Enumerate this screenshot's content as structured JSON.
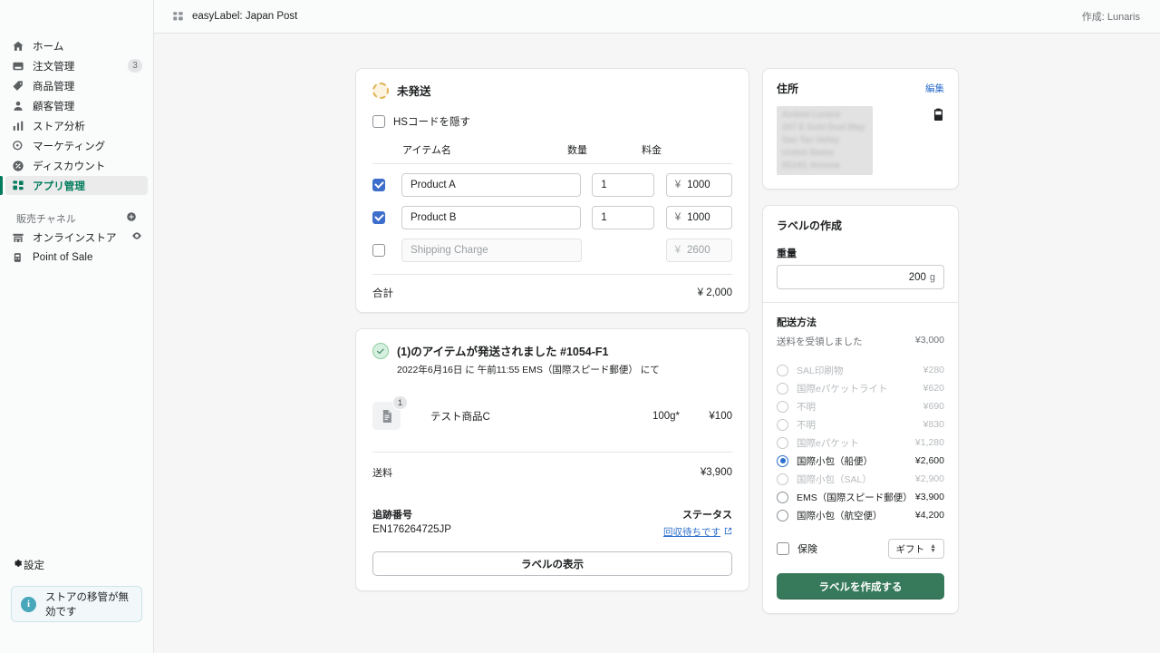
{
  "sidebar": {
    "items": [
      {
        "label": "ホーム",
        "icon": "home-icon",
        "badge": ""
      },
      {
        "label": "注文管理",
        "icon": "orders-icon",
        "badge": "3"
      },
      {
        "label": "商品管理",
        "icon": "products-icon",
        "badge": ""
      },
      {
        "label": "顧客管理",
        "icon": "customers-icon",
        "badge": ""
      },
      {
        "label": "ストア分析",
        "icon": "analytics-icon",
        "badge": ""
      },
      {
        "label": "マーケティング",
        "icon": "marketing-icon",
        "badge": ""
      },
      {
        "label": "ディスカウント",
        "icon": "discount-icon",
        "badge": ""
      },
      {
        "label": "アプリ管理",
        "icon": "apps-icon",
        "badge": ""
      }
    ],
    "active_index": 7,
    "section_title": "販売チャネル",
    "channels": [
      {
        "label": "オンラインストア",
        "icon": "store-icon",
        "trailing_icon": "eye-icon"
      },
      {
        "label": "Point of Sale",
        "icon": "pos-icon",
        "trailing_icon": ""
      }
    ],
    "settings_label": "設定",
    "notice": {
      "text": "ストアの移管が無効です",
      "icon": "info-icon"
    }
  },
  "topbar": {
    "app_icon": "apps-grid-icon",
    "app_name": "easyLabel: Japan Post",
    "author": "作成: Lunaris"
  },
  "unfulfilled": {
    "status_label": "未発送",
    "status_icon": "dashed-circle-icon",
    "hide_hs_label": "HSコードを隠す",
    "hide_hs_checked": false,
    "columns": {
      "name": "アイテム名",
      "qty": "数量",
      "fee": "料金"
    },
    "rows": [
      {
        "checked": true,
        "name": "Product A",
        "name_placeholder": "",
        "qty": "1",
        "currency": "¥",
        "fee": "1000",
        "disabled": false
      },
      {
        "checked": true,
        "name": "Product B",
        "name_placeholder": "",
        "qty": "1",
        "currency": "¥",
        "fee": "1000",
        "disabled": false
      },
      {
        "checked": false,
        "name": "",
        "name_placeholder": "Shipping Charge",
        "qty": "",
        "currency": "¥",
        "fee": "2600",
        "disabled": true
      }
    ],
    "total_label": "合計",
    "total_value": "¥ 2,000"
  },
  "fulfilled": {
    "title": "(1)のアイテムが発送されました  #1054-F1",
    "subtitle": "2022年6月16日 に 午前11:55 EMS（国際スピード郵便） にて",
    "status_icon": "check-circle-icon",
    "item": {
      "thumb_icon": "document-icon",
      "qty_badge": "1",
      "name": "テスト商品C",
      "weight": "100g*",
      "price": "¥100"
    },
    "shipping_label": "送料",
    "shipping_value": "¥3,900",
    "tracking_label": "追跡番号",
    "tracking_value": "EN176264725JP",
    "status_label": "ステータス",
    "status_value": "回収待ちです",
    "status_external_icon": "external-link-icon",
    "view_label_button": "ラベルの表示"
  },
  "address_card": {
    "title": "住所",
    "edit_label": "編集",
    "copy_icon": "clipboard-icon",
    "lines": [
      "Azdewi Lunaris",
      "247 E Gold Dust Way",
      "San Tan Valley",
      "United States",
      "85143, Arizona"
    ]
  },
  "label_card": {
    "title": "ラベルの作成",
    "weight_label": "重量",
    "weight_value": "200",
    "weight_unit": "g",
    "method_title": "配送方法",
    "collected_label": "送料を受領しました",
    "collected_value": "¥3,000",
    "methods": [
      {
        "label": "SAL印刷物",
        "price": "¥280",
        "selected": false,
        "enabled": false
      },
      {
        "label": "国際eパケットライト",
        "price": "¥620",
        "selected": false,
        "enabled": false
      },
      {
        "label": "不明",
        "price": "¥690",
        "selected": false,
        "enabled": false
      },
      {
        "label": "不明",
        "price": "¥830",
        "selected": false,
        "enabled": false
      },
      {
        "label": "国際eパケット",
        "price": "¥1,280",
        "selected": false,
        "enabled": false
      },
      {
        "label": "国際小包（船便）",
        "price": "¥2,600",
        "selected": true,
        "enabled": true
      },
      {
        "label": "国際小包（SAL）",
        "price": "¥2,900",
        "selected": false,
        "enabled": false
      },
      {
        "label": "EMS（国際スピード郵便）",
        "price": "¥3,900",
        "selected": false,
        "enabled": true
      },
      {
        "label": "国際小包（航空便）",
        "price": "¥4,200",
        "selected": false,
        "enabled": true
      }
    ],
    "insurance_label": "保険",
    "insurance_checked": false,
    "gift_select_value": "ギフト",
    "create_button": "ラベルを作成する"
  },
  "colors": {
    "accent_green": "#367a5b",
    "link_blue": "#2c6ecb",
    "checkbox_blue": "#3d6ecb",
    "warning_amber": "#e0b252",
    "info_teal": "#48a7bb"
  }
}
